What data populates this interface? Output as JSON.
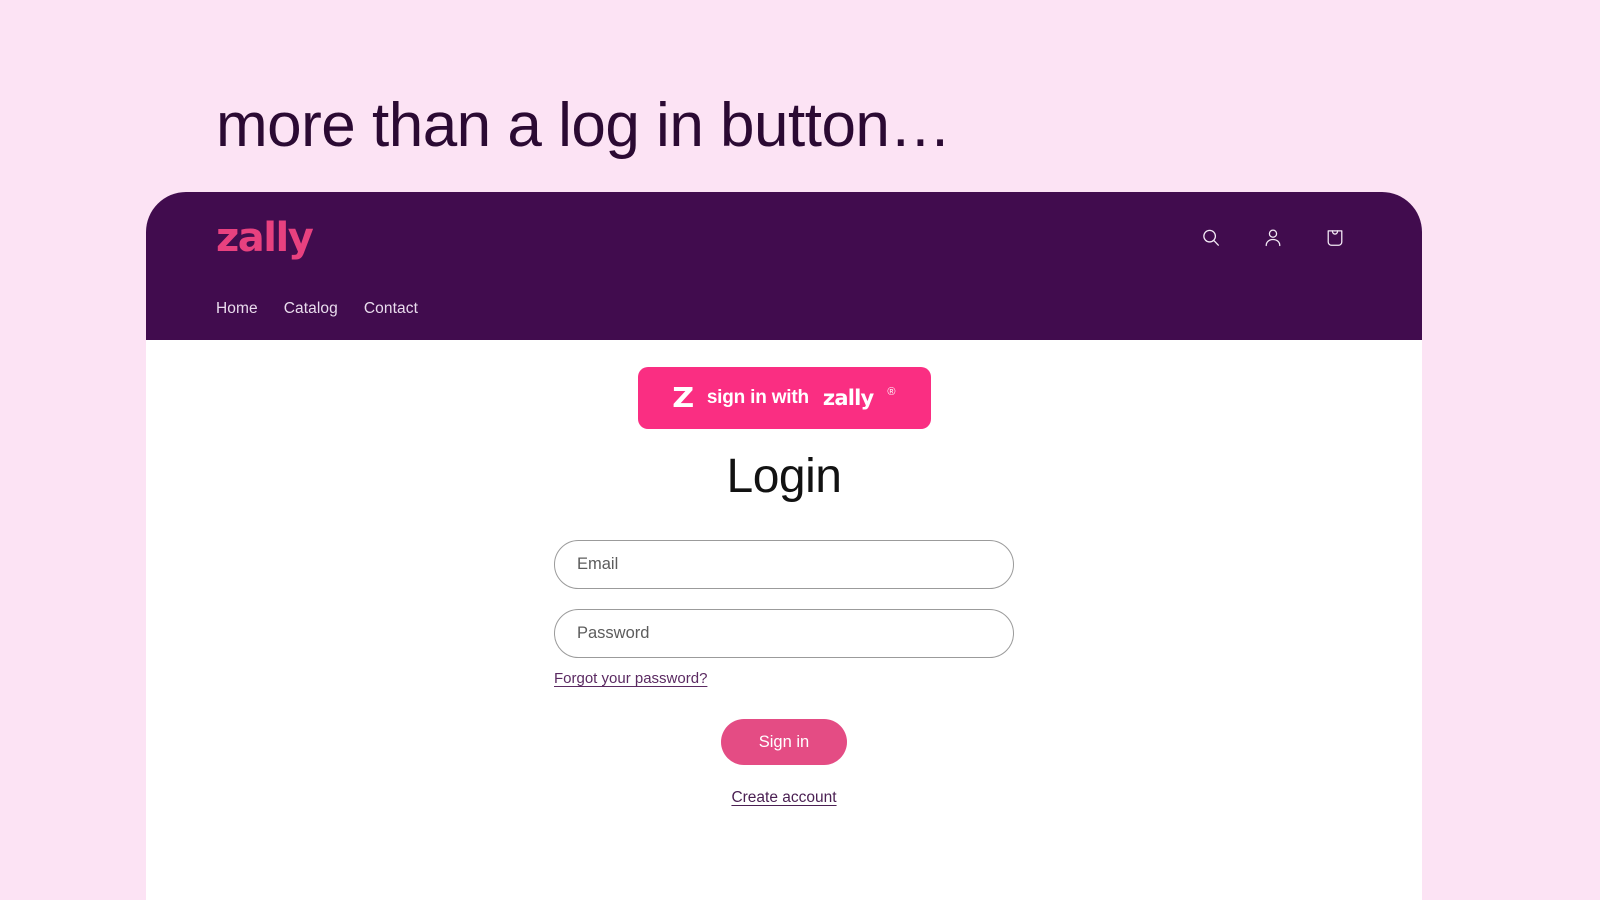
{
  "page": {
    "background_color": "#fce3f4",
    "headline": "more than a log in button…"
  },
  "site_header": {
    "background_color": "#410c4e",
    "logo_text": "zally",
    "logo_color": "#e8417f",
    "icons": [
      {
        "name": "search-icon",
        "label": "Search"
      },
      {
        "name": "account-icon",
        "label": "Log in"
      },
      {
        "name": "cart-icon",
        "label": "Cart"
      }
    ],
    "nav": [
      {
        "label": "Home"
      },
      {
        "label": "Catalog"
      },
      {
        "label": "Contact"
      }
    ]
  },
  "main": {
    "zally_button": {
      "mark": "Z",
      "text": "sign in with",
      "brand": "zally",
      "registered": "®",
      "color": "#fa2e82"
    },
    "title": "Login",
    "form": {
      "email_placeholder": "Email",
      "password_placeholder": "Password",
      "email_value": "",
      "password_value": "",
      "forgot_label": "Forgot your password?",
      "submit_label": "Sign in",
      "submit_color": "#e44c84",
      "create_account_label": "Create account"
    }
  }
}
